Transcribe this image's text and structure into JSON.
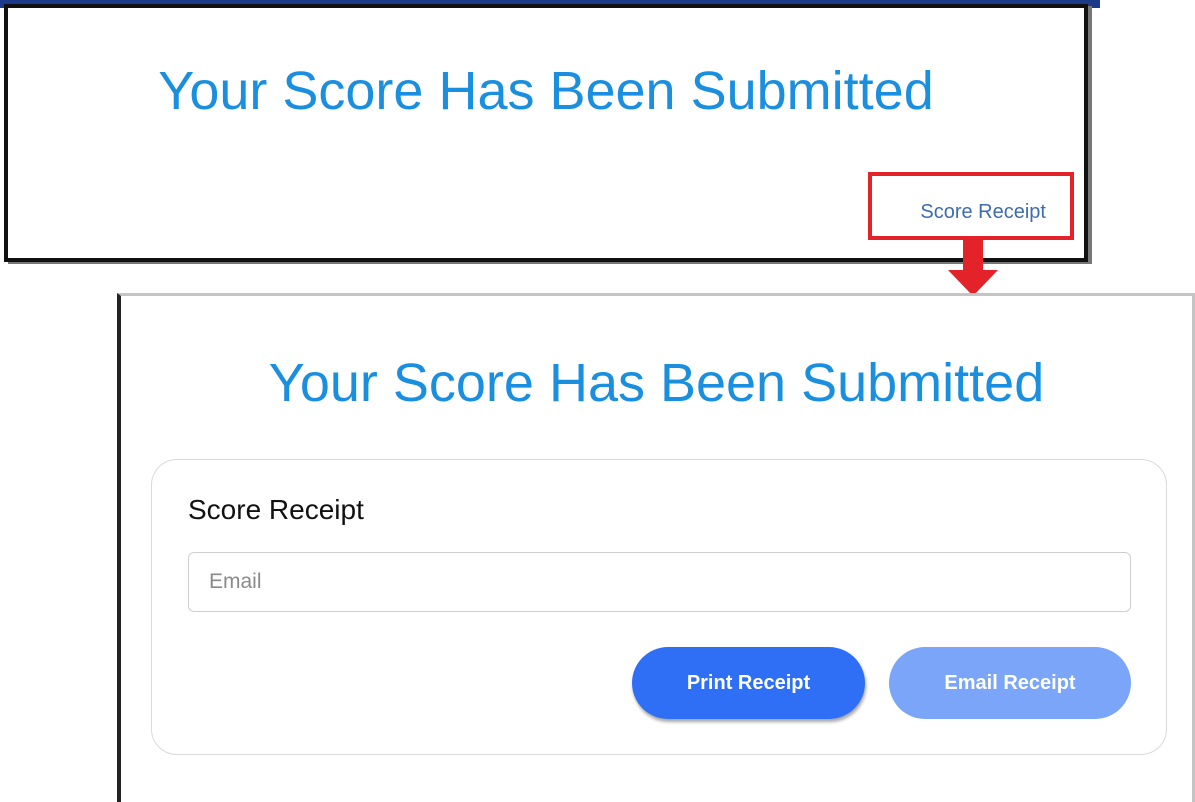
{
  "top_panel": {
    "title": "Your Score Has Been Submitted",
    "link_label": "Score Receipt"
  },
  "bottom_panel": {
    "title": "Your Score Has Been Submitted",
    "card": {
      "title": "Score Receipt",
      "email": {
        "placeholder": "Email",
        "value": ""
      },
      "print_button_label": "Print Receipt",
      "email_button_label": "Email Receipt"
    }
  },
  "colors": {
    "title_blue": "#1a8fe0",
    "link_blue": "#3d6cb0",
    "highlight_red": "#e3222a",
    "primary_button": "#2f6ff5",
    "disabled_button": "#7aa5f8"
  },
  "icons": [
    "arrow-down-annotation"
  ]
}
